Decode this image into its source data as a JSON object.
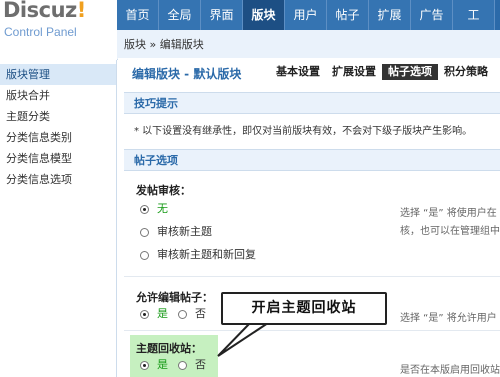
{
  "logo": {
    "word": "Discuz",
    "bang": "!",
    "sub": "Control Panel"
  },
  "nav": {
    "tabs": [
      "首页",
      "全局",
      "界面",
      "版块",
      "用户",
      "帖子",
      "扩展",
      "广告",
      "工"
    ]
  },
  "breadcrumb": "版块 » 编辑版块",
  "sidebar": {
    "items": [
      "版块管理",
      "版块合并",
      "主题分类",
      "分类信息类别",
      "分类信息模型",
      "分类信息选项"
    ]
  },
  "page": {
    "title": "编辑版块 - 默认版块",
    "subtabs": [
      "基本设置",
      "扩展设置",
      "帖子选项",
      "积分策略"
    ]
  },
  "tips": {
    "heading": "技巧提示",
    "text": "* 以下设置没有继承性，即仅对当前版块有效，不会对下级子版块产生影响。"
  },
  "post_options": {
    "heading": "帖子选项",
    "review": {
      "label": "发帖审核：",
      "options": [
        "无",
        "审核新主题",
        "审核新主题和新回复"
      ],
      "desc_line1": "选择 “是” 将使用户在",
      "desc_line2": "核，也可以在管理组中"
    },
    "allow_edit": {
      "label": "允许编辑帖子：",
      "yes": "是",
      "no": "否",
      "desc": "选择 “是” 将允许用户"
    },
    "recycle": {
      "label": "主题回收站：",
      "yes": "是",
      "no": "否",
      "desc": "是否在本版启用回收站"
    }
  },
  "callout": {
    "text": "开启主题回收站"
  },
  "colors": {
    "nav_blue": "#2b6aa9",
    "active_tab": "#1d4f84",
    "highlight_green": "#c6f0c0"
  }
}
